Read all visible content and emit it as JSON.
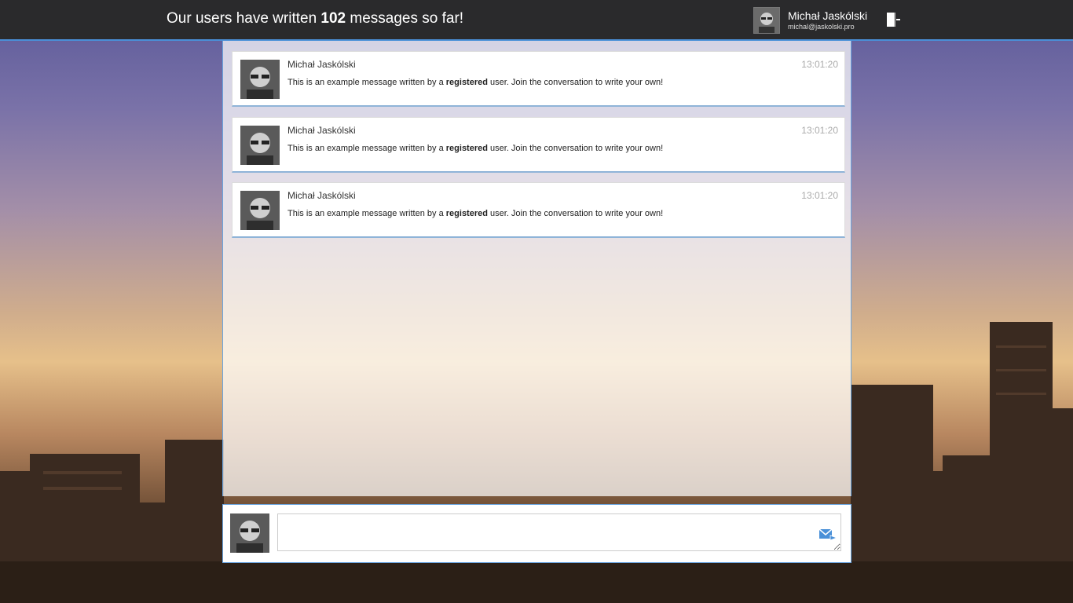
{
  "header": {
    "headline_prefix": "Our users have written",
    "message_count": "102",
    "headline_suffix": "messages so far!"
  },
  "user": {
    "name": "Michał Jaskólski",
    "email": "michal@jaskolski.pro",
    "avatar_icon": "avatar-photo",
    "logout_icon": "logout-door-icon"
  },
  "messages": [
    {
      "author": "Michał Jaskólski",
      "time": "13:01:20",
      "text_before": "This is an example message written by a",
      "text_bold": "registered",
      "text_after": "user. Join the conversation to write your own!"
    },
    {
      "author": "Michał Jaskólski",
      "time": "13:01:20",
      "text_before": "This is an example message written by a",
      "text_bold": "registered",
      "text_after": "user. Join the conversation to write your own!"
    },
    {
      "author": "Michał Jaskólski",
      "time": "13:01:20",
      "text_before": "This is an example message written by a",
      "text_bold": "registered",
      "text_after": "user. Join the conversation to write your own!"
    }
  ],
  "composer": {
    "value": "",
    "placeholder": "",
    "send_icon": "send-mail-icon"
  },
  "colors": {
    "topbar": "#2a2a2c",
    "accent": "#4a90d8"
  }
}
